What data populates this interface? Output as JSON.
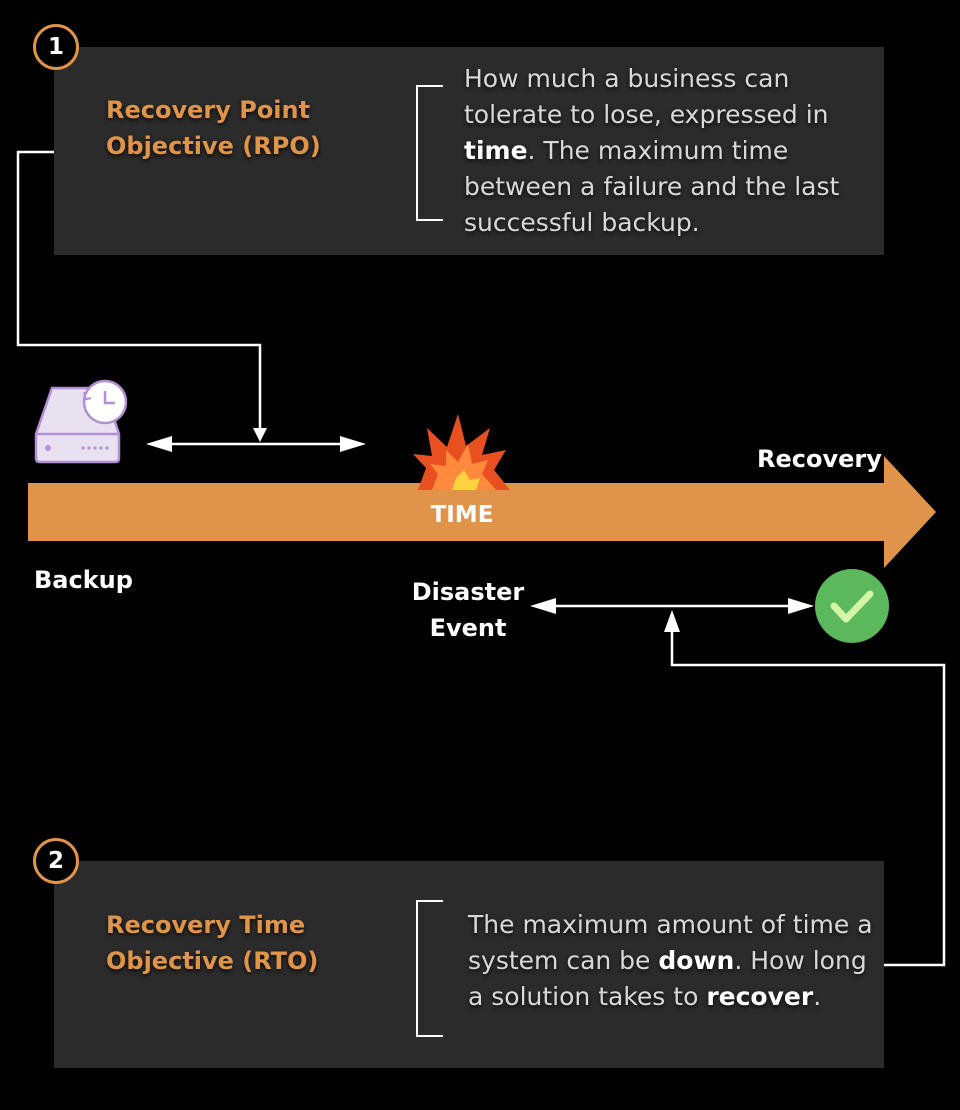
{
  "rpo": {
    "number": "1",
    "title_line1": "Recovery Point",
    "title_line2": "Objective (RPO)",
    "desc_line1": "How much a business can",
    "desc_line2": "tolerate to lose, expressed in",
    "desc_line3_bold": "time",
    "desc_line3_rest": ". The maximum time",
    "desc_line4": "between a failure and the last",
    "desc_line5": "successful backup."
  },
  "rto": {
    "number": "2",
    "title_line1": "Recovery Time",
    "title_line2": "Objective (RTO)",
    "desc_line1": "The maximum amount of time a",
    "desc_line2_pre": "system can be ",
    "desc_line2_bold": "down",
    "desc_line2_post": ". How long",
    "desc_line3_pre": "a solution takes to ",
    "desc_line3_bold": "recover",
    "desc_line3_post": "."
  },
  "timeline": {
    "time_label": "TIME",
    "recovery_label": "Recovery",
    "backup_label": "Backup",
    "disaster_line1": "Disaster",
    "disaster_line2": "Event"
  },
  "icons": {
    "backup": "backup-drive-clock-icon",
    "disaster": "explosion-icon",
    "recovery": "checkmark-circle-icon"
  },
  "colors": {
    "accent": "#e0944a",
    "panel": "#2b2b2b",
    "success": "#5cb85c",
    "check": "#d4f5a8"
  }
}
